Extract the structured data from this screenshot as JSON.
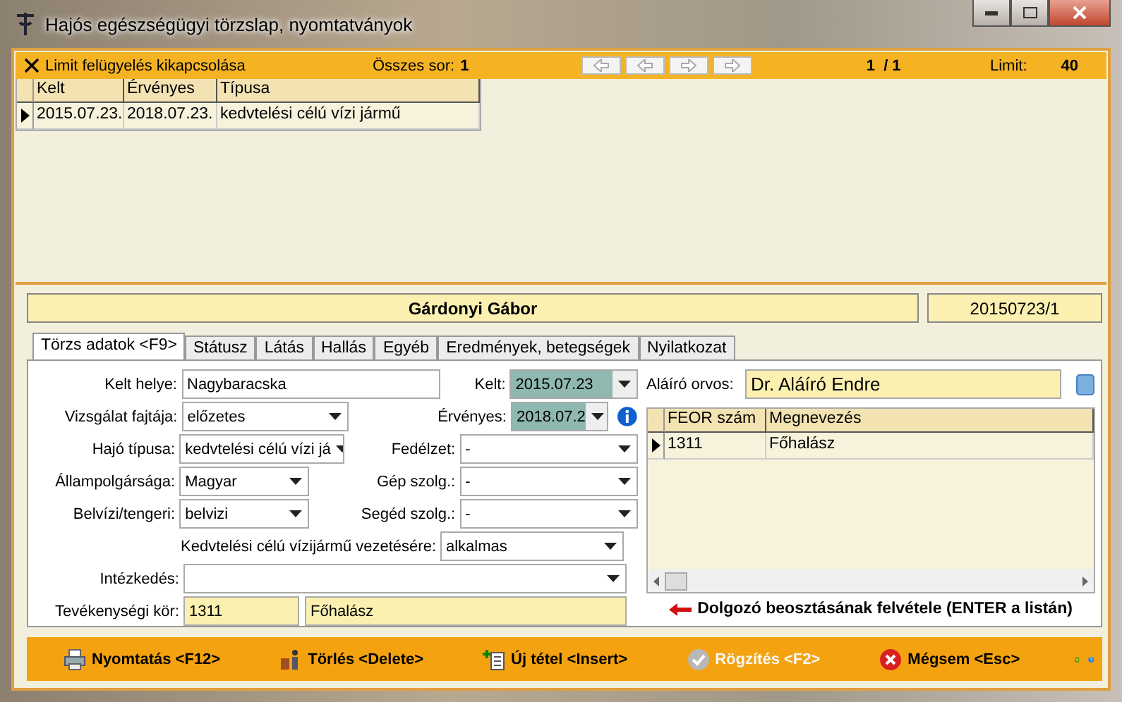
{
  "window": {
    "title": "Hajós egészségügyi törzslap, nyomtatványok"
  },
  "toolbar": {
    "limit_toggle": "Limit felügyelés kikapcsolása",
    "total_label": "Összes sor:",
    "total": "1",
    "page": "1  / 1",
    "limit_label": "Limit:",
    "limit": "40"
  },
  "grid": {
    "columns": [
      "Kelt",
      "Érvényes",
      "Típusa"
    ],
    "rows": [
      {
        "selected": true,
        "cells": [
          "2015.07.23.",
          "2018.07.23.",
          "kedvtelési célú vízi jármű"
        ]
      }
    ]
  },
  "person": {
    "name": "Gárdonyi Gábor",
    "id": "20150723/1"
  },
  "tabs": [
    {
      "label": "Törzs adatok <F9>",
      "selected": true
    },
    {
      "label": "Státusz",
      "selected": false
    },
    {
      "label": "Látás",
      "selected": false
    },
    {
      "label": "Hallás",
      "selected": false
    },
    {
      "label": "Egyéb",
      "selected": false
    },
    {
      "label": "Eredmények, betegségek",
      "selected": false
    },
    {
      "label": "Nyilatkozat",
      "selected": false
    }
  ],
  "form": [
    {
      "fields": [
        {
          "label": "Kelt helye:",
          "kind": "text",
          "value": "Nagybaracska"
        },
        {
          "label": "Kelt:",
          "kind": "date",
          "value": "2015.07.23"
        }
      ]
    },
    {
      "fields": [
        {
          "label": "Vizsgálat fajtája:",
          "kind": "select",
          "value": "előzetes"
        },
        {
          "label": "Érvényes:",
          "kind": "date",
          "value": "2018.07.2",
          "info": true
        }
      ]
    },
    {
      "fields": [
        {
          "label": "Hajó típusa:",
          "kind": "select",
          "value": "kedvtelési célú vízi já"
        },
        {
          "label": "Fedélzet:",
          "kind": "select",
          "value": "-"
        }
      ]
    },
    {
      "fields": [
        {
          "label": "Állampolgársága:",
          "kind": "select",
          "value": "Magyar"
        },
        {
          "label": "Gép szolg.:",
          "kind": "select",
          "value": "-"
        }
      ]
    },
    {
      "fields": [
        {
          "label": "Belvízi/tengeri:",
          "kind": "select",
          "value": "belvizi"
        },
        {
          "label": "Segéd szolg.:",
          "kind": "select",
          "value": "-"
        }
      ]
    },
    {
      "fields": [
        {
          "label": "Kedvtelési célú vízijármű vezetésére:",
          "kind": "select",
          "value": "alkalmas"
        }
      ]
    },
    {
      "fields": [
        {
          "label": "Intézkedés:",
          "kind": "select"
        }
      ]
    },
    {
      "fields": [
        {
          "label": "Tevékenységi kör:",
          "kind": "readonly",
          "value": "1311"
        },
        {
          "kind": "readonly",
          "value": "Főhalász"
        }
      ]
    }
  ],
  "signer": {
    "label": "Aláíró orvos:",
    "value": "Dr. Aláíró Endre"
  },
  "feor": {
    "columns": [
      "FEOR szám",
      "Megnevezés"
    ],
    "rows": [
      {
        "selected": true,
        "cells": [
          "1311",
          "Főhalász"
        ]
      }
    ]
  },
  "hint": "Dolgozó beosztásának felvétele (ENTER a listán)",
  "actions": [
    {
      "kind": "print",
      "label": "Nyomtatás <F12>",
      "disabled": false
    },
    {
      "kind": "delete",
      "label": "Törlés <Delete>",
      "disabled": false
    },
    {
      "kind": "new",
      "label": "Új tétel <Insert>",
      "disabled": false
    },
    {
      "kind": "save",
      "label": "Rögzítés <F2>",
      "disabled": true
    },
    {
      "kind": "cancel",
      "label": "Mégsem <Esc>",
      "disabled": false
    }
  ]
}
